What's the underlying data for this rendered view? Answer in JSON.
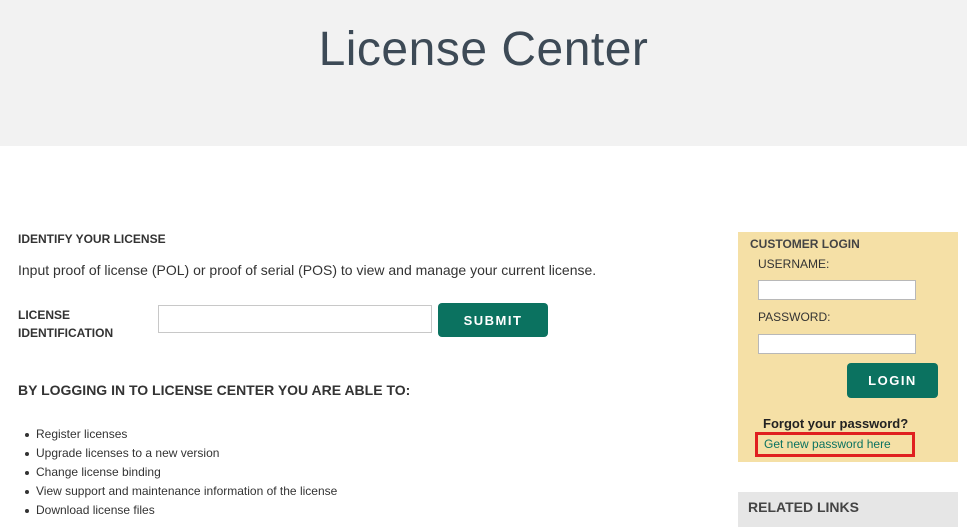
{
  "header": {
    "title": "License Center"
  },
  "identify": {
    "title": "IDENTIFY YOUR LICENSE",
    "intro": "Input proof of license (POL) or proof of serial (POS) to view and manage your current license.",
    "field_label_line1": "LICENSE",
    "field_label_line2": "IDENTIFICATION",
    "input_value": "",
    "input_placeholder": "",
    "submit_label": "SUBMIT"
  },
  "benefits": {
    "heading": "BY LOGGING IN TO LICENSE CENTER YOU ARE ABLE TO:",
    "items": [
      "Register licenses",
      "Upgrade licenses to a new version",
      "Change license binding",
      "View support and maintenance information of the license",
      "Download license files"
    ]
  },
  "login": {
    "title": "CUSTOMER LOGIN",
    "username_label": "USERNAME:",
    "username_value": "",
    "password_label": "PASSWORD:",
    "password_value": "",
    "login_label": "LOGIN",
    "forgot_text": "Forgot your password?",
    "reset_link": "Get new password here"
  },
  "related": {
    "title": "RELATED LINKS"
  },
  "colors": {
    "accent": "#0b7260",
    "header_bg": "#f2f2f2",
    "login_bg": "#f5e0a6",
    "highlight": "#e02020",
    "related_bg": "#e6e6e6"
  }
}
